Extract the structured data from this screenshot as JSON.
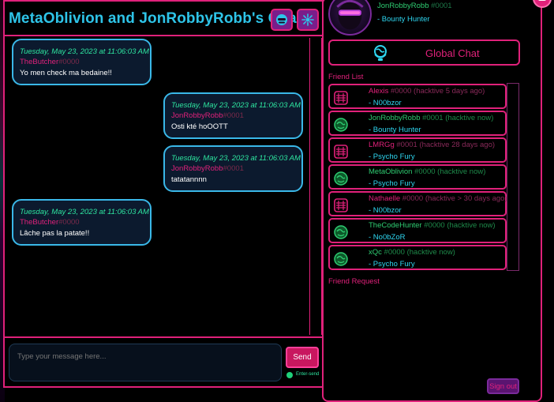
{
  "chat": {
    "title": "MetaOblivion and JonRobbyRobb's Chat",
    "header_icons": [
      "user-icon",
      "settings-icon"
    ],
    "messages": [
      {
        "timestamp": "Tuesday, May 23, 2023 at 11:06:03 AM",
        "author": "TheButcher",
        "tag": "#0000",
        "text": "Yo men check ma bedaine!!",
        "side": "left"
      },
      {
        "timestamp": "Tuesday, May 23, 2023 at 11:06:03 AM",
        "author": "JonRobbyRobb",
        "tag": "#0001",
        "text": "Osti kté hoOOTT",
        "side": "right"
      },
      {
        "timestamp": "Tuesday, May 23, 2023 at 11:06:03 AM",
        "author": "JonRobbyRobb",
        "tag": "#0001",
        "text": "tatatannnn",
        "side": "right"
      },
      {
        "timestamp": "Tuesday, May 23, 2023 at 11:06:03 AM",
        "author": "TheButcher",
        "tag": "#0000",
        "text": "Lâche pas la patate!!",
        "side": "left"
      }
    ],
    "input_placeholder": "Type your message here...",
    "send_label": "Send",
    "enter_send_label": "Enter-send"
  },
  "profile": {
    "name": "JonRobbyRobb",
    "tag": "#0001",
    "status": "- Bounty Hunter"
  },
  "global_chat_label": "Global Chat",
  "friend_list_label": "Friend List",
  "friend_request_label": "Friend Request",
  "friends": [
    {
      "name": "Alexis",
      "tag": "#0000",
      "activity": "(hacktive 5 days ago)",
      "title": "- N00bzor",
      "online": false
    },
    {
      "name": "JonRobbyRobb",
      "tag": "#0001",
      "activity": "(hacktive now)",
      "title": "- Bounty Hunter",
      "online": true
    },
    {
      "name": "LMRGg",
      "tag": "#0001",
      "activity": "(hacktive 28 days ago)",
      "title": "- Psycho Fury",
      "online": false
    },
    {
      "name": "MetaOblivion",
      "tag": "#0000",
      "activity": "(hacktive now)",
      "title": "- Psycho Fury",
      "online": true
    },
    {
      "name": "Nathaelle",
      "tag": "#0000",
      "activity": "(hacktive > 30 days ago)",
      "title": "- N00bzor",
      "online": false
    },
    {
      "name": "TheCodeHunter",
      "tag": "#0000",
      "activity": "(hacktive now)",
      "title": "- No0bZoR",
      "online": true
    },
    {
      "name": "xQc",
      "tag": "#0000",
      "activity": "(hacktive now)",
      "title": "- Psycho Fury",
      "online": true
    }
  ],
  "signout_label": "Sign out",
  "colors": {
    "accent": "#e0217a",
    "title": "#2ec4e8",
    "online": "#2ecc71",
    "timestamp": "#2ee6a0",
    "bubble_border": "#3ab8e8"
  }
}
